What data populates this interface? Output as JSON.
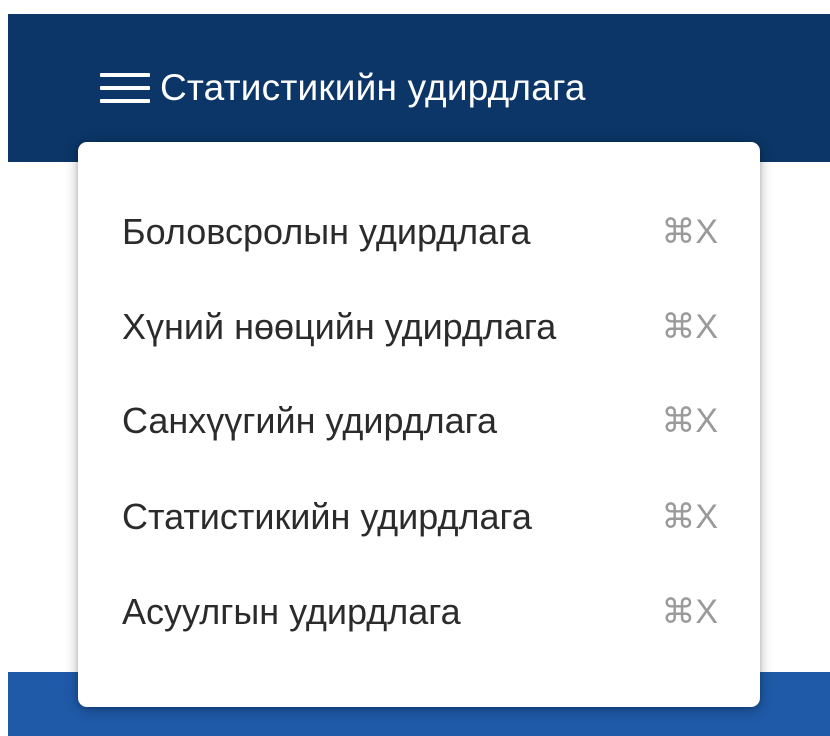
{
  "header": {
    "title": "Статистикийн удирдлага",
    "menu_icon": "hamburger-menu-icon",
    "background_color": "#0b3667"
  },
  "dropdown": {
    "items": [
      {
        "label": "Боловсролын удирдлага",
        "shortcut": "⌘X"
      },
      {
        "label": "Хүний нөөцийн удирдлага",
        "shortcut": "⌘X"
      },
      {
        "label": "Санхүүгийн удирдлага",
        "shortcut": "⌘X"
      },
      {
        "label": "Статистикийн удирдлага",
        "shortcut": "⌘X"
      },
      {
        "label": "Асуулгын удирдлага",
        "shortcut": "⌘X"
      }
    ]
  },
  "footer": {
    "background_color": "#1f5aa8"
  }
}
